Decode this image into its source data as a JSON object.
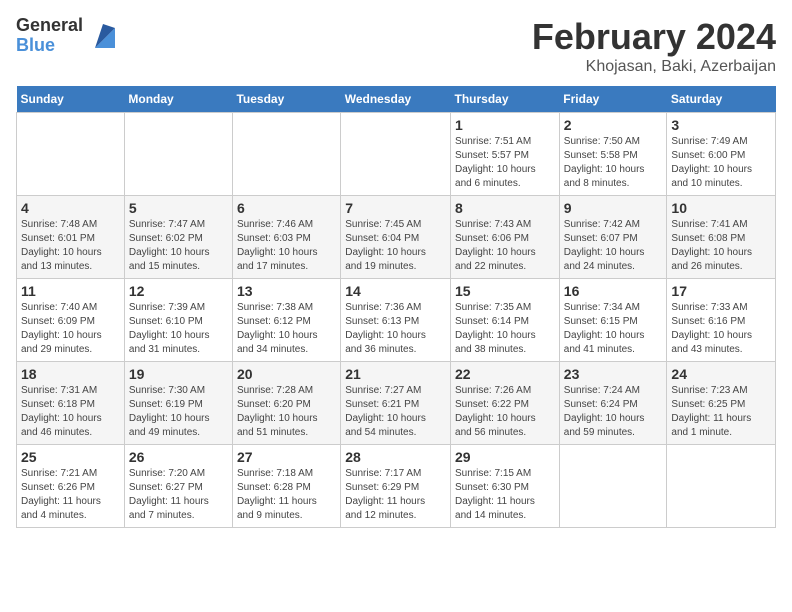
{
  "header": {
    "logo_general": "General",
    "logo_blue": "Blue",
    "month_title": "February 2024",
    "location": "Khojasan, Baki, Azerbaijan"
  },
  "weekdays": [
    "Sunday",
    "Monday",
    "Tuesday",
    "Wednesday",
    "Thursday",
    "Friday",
    "Saturday"
  ],
  "weeks": [
    {
      "days": [
        {
          "number": "",
          "info": ""
        },
        {
          "number": "",
          "info": ""
        },
        {
          "number": "",
          "info": ""
        },
        {
          "number": "",
          "info": ""
        },
        {
          "number": "1",
          "info": "Sunrise: 7:51 AM\nSunset: 5:57 PM\nDaylight: 10 hours\nand 6 minutes."
        },
        {
          "number": "2",
          "info": "Sunrise: 7:50 AM\nSunset: 5:58 PM\nDaylight: 10 hours\nand 8 minutes."
        },
        {
          "number": "3",
          "info": "Sunrise: 7:49 AM\nSunset: 6:00 PM\nDaylight: 10 hours\nand 10 minutes."
        }
      ]
    },
    {
      "days": [
        {
          "number": "4",
          "info": "Sunrise: 7:48 AM\nSunset: 6:01 PM\nDaylight: 10 hours\nand 13 minutes."
        },
        {
          "number": "5",
          "info": "Sunrise: 7:47 AM\nSunset: 6:02 PM\nDaylight: 10 hours\nand 15 minutes."
        },
        {
          "number": "6",
          "info": "Sunrise: 7:46 AM\nSunset: 6:03 PM\nDaylight: 10 hours\nand 17 minutes."
        },
        {
          "number": "7",
          "info": "Sunrise: 7:45 AM\nSunset: 6:04 PM\nDaylight: 10 hours\nand 19 minutes."
        },
        {
          "number": "8",
          "info": "Sunrise: 7:43 AM\nSunset: 6:06 PM\nDaylight: 10 hours\nand 22 minutes."
        },
        {
          "number": "9",
          "info": "Sunrise: 7:42 AM\nSunset: 6:07 PM\nDaylight: 10 hours\nand 24 minutes."
        },
        {
          "number": "10",
          "info": "Sunrise: 7:41 AM\nSunset: 6:08 PM\nDaylight: 10 hours\nand 26 minutes."
        }
      ]
    },
    {
      "days": [
        {
          "number": "11",
          "info": "Sunrise: 7:40 AM\nSunset: 6:09 PM\nDaylight: 10 hours\nand 29 minutes."
        },
        {
          "number": "12",
          "info": "Sunrise: 7:39 AM\nSunset: 6:10 PM\nDaylight: 10 hours\nand 31 minutes."
        },
        {
          "number": "13",
          "info": "Sunrise: 7:38 AM\nSunset: 6:12 PM\nDaylight: 10 hours\nand 34 minutes."
        },
        {
          "number": "14",
          "info": "Sunrise: 7:36 AM\nSunset: 6:13 PM\nDaylight: 10 hours\nand 36 minutes."
        },
        {
          "number": "15",
          "info": "Sunrise: 7:35 AM\nSunset: 6:14 PM\nDaylight: 10 hours\nand 38 minutes."
        },
        {
          "number": "16",
          "info": "Sunrise: 7:34 AM\nSunset: 6:15 PM\nDaylight: 10 hours\nand 41 minutes."
        },
        {
          "number": "17",
          "info": "Sunrise: 7:33 AM\nSunset: 6:16 PM\nDaylight: 10 hours\nand 43 minutes."
        }
      ]
    },
    {
      "days": [
        {
          "number": "18",
          "info": "Sunrise: 7:31 AM\nSunset: 6:18 PM\nDaylight: 10 hours\nand 46 minutes."
        },
        {
          "number": "19",
          "info": "Sunrise: 7:30 AM\nSunset: 6:19 PM\nDaylight: 10 hours\nand 49 minutes."
        },
        {
          "number": "20",
          "info": "Sunrise: 7:28 AM\nSunset: 6:20 PM\nDaylight: 10 hours\nand 51 minutes."
        },
        {
          "number": "21",
          "info": "Sunrise: 7:27 AM\nSunset: 6:21 PM\nDaylight: 10 hours\nand 54 minutes."
        },
        {
          "number": "22",
          "info": "Sunrise: 7:26 AM\nSunset: 6:22 PM\nDaylight: 10 hours\nand 56 minutes."
        },
        {
          "number": "23",
          "info": "Sunrise: 7:24 AM\nSunset: 6:24 PM\nDaylight: 10 hours\nand 59 minutes."
        },
        {
          "number": "24",
          "info": "Sunrise: 7:23 AM\nSunset: 6:25 PM\nDaylight: 11 hours\nand 1 minute."
        }
      ]
    },
    {
      "days": [
        {
          "number": "25",
          "info": "Sunrise: 7:21 AM\nSunset: 6:26 PM\nDaylight: 11 hours\nand 4 minutes."
        },
        {
          "number": "26",
          "info": "Sunrise: 7:20 AM\nSunset: 6:27 PM\nDaylight: 11 hours\nand 7 minutes."
        },
        {
          "number": "27",
          "info": "Sunrise: 7:18 AM\nSunset: 6:28 PM\nDaylight: 11 hours\nand 9 minutes."
        },
        {
          "number": "28",
          "info": "Sunrise: 7:17 AM\nSunset: 6:29 PM\nDaylight: 11 hours\nand 12 minutes."
        },
        {
          "number": "29",
          "info": "Sunrise: 7:15 AM\nSunset: 6:30 PM\nDaylight: 11 hours\nand 14 minutes."
        },
        {
          "number": "",
          "info": ""
        },
        {
          "number": "",
          "info": ""
        }
      ]
    }
  ]
}
